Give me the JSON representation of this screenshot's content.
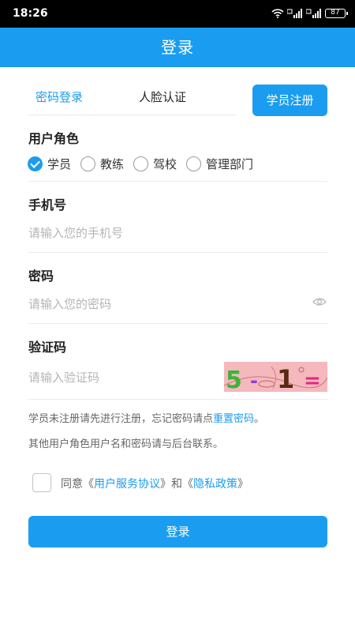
{
  "status_bar": {
    "time": "18:26",
    "battery": "87",
    "icons": [
      "wifi-icon",
      "signal-hd-icon",
      "signal-hd-icon",
      "battery-icon"
    ]
  },
  "header": {
    "title": "登录"
  },
  "tabs": {
    "password_login": "密码登录",
    "face_auth": "人脸认证"
  },
  "register_button": "学员注册",
  "role": {
    "label": "用户角色",
    "options": [
      "学员",
      "教练",
      "驾校",
      "管理部门"
    ],
    "selected": "学员"
  },
  "phone": {
    "label": "手机号",
    "placeholder": "请输入您的手机号"
  },
  "password": {
    "label": "密码",
    "placeholder": "请输入您的密码"
  },
  "captcha": {
    "label": "验证码",
    "placeholder": "请输入验证码",
    "image_text": [
      "5",
      "-",
      "1",
      "="
    ]
  },
  "notes": {
    "line1_prefix": "学员未注册请先进行注册，忘记密码请点",
    "line1_link": "重置密码",
    "line1_suffix": "。",
    "line2": "其他用户角色用户名和密码请与后台联系。"
  },
  "agreement": {
    "checked": false,
    "prefix": "同意《",
    "service_link": "用户服务协议",
    "middle": "》和《",
    "privacy_link": "隐私政策",
    "suffix": "》"
  },
  "login_button": "登录",
  "colors": {
    "accent": "#1a9df0",
    "placeholder": "#b5b5b5",
    "captcha_bg": "#f5b8bd"
  }
}
